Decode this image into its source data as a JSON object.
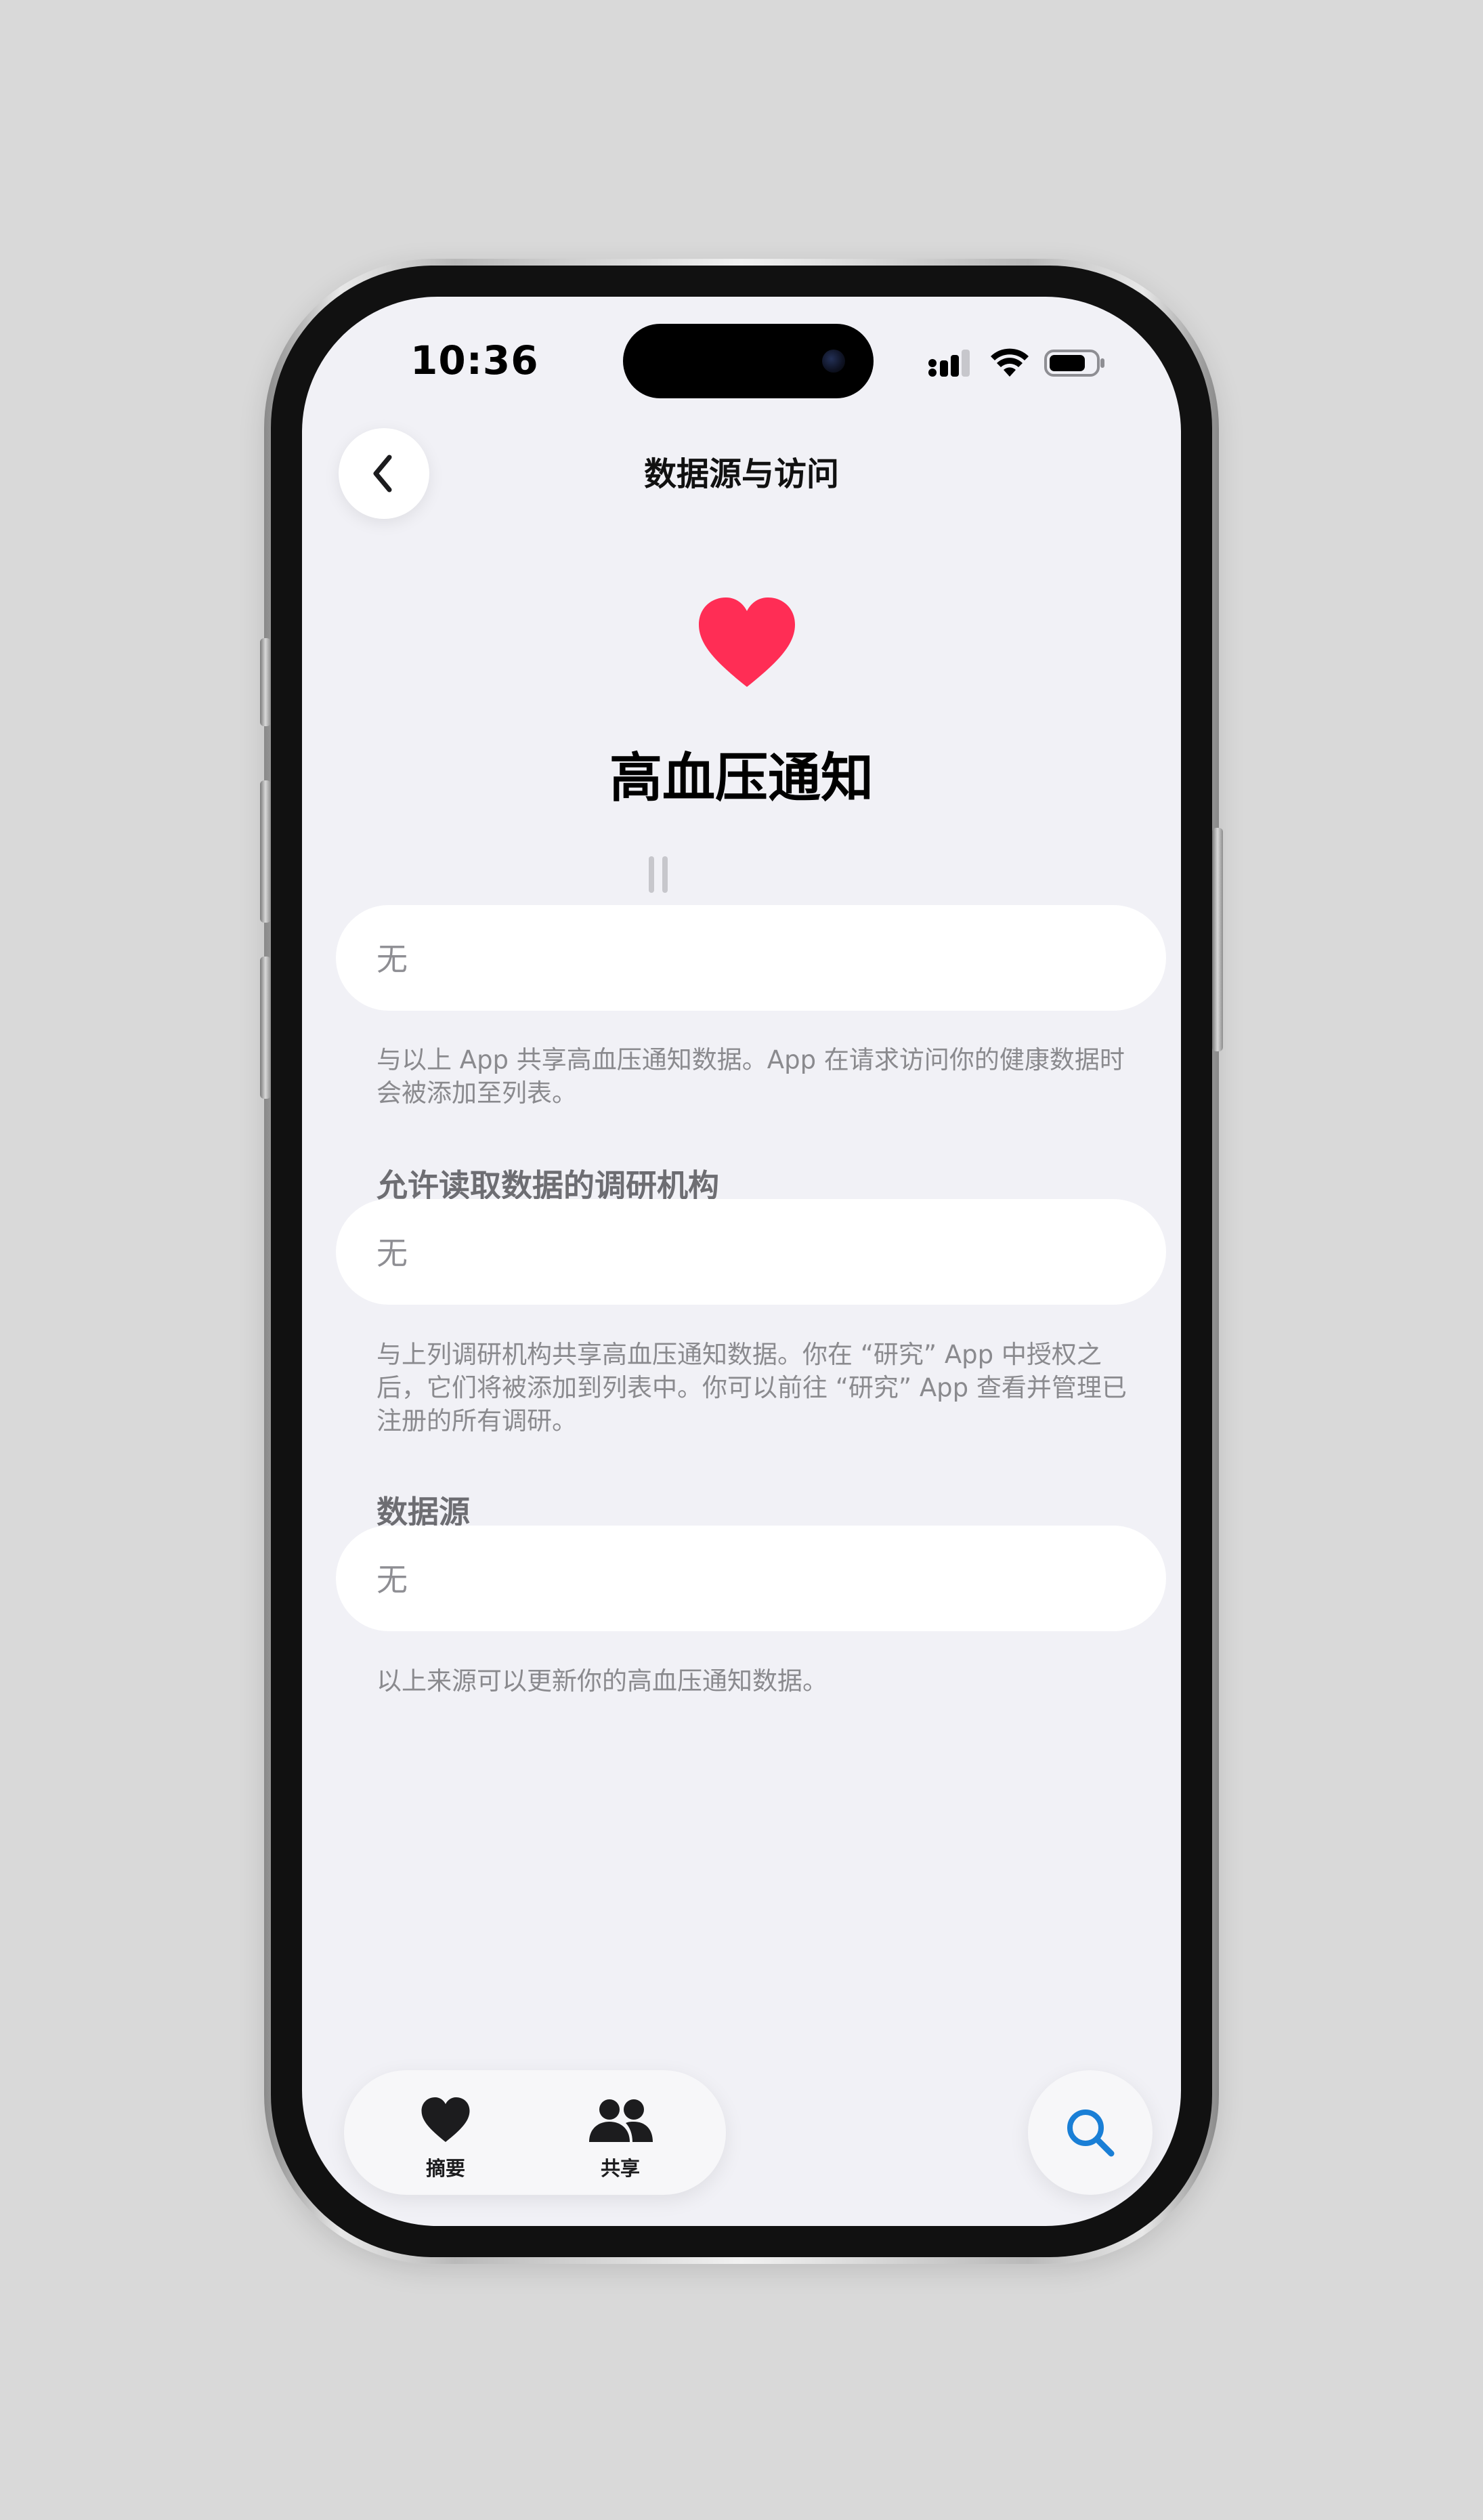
{
  "status_bar": {
    "time": "10:36"
  },
  "nav": {
    "title": "数据源与访问"
  },
  "hero": {
    "title": "高血压通知",
    "icon": "heart-icon",
    "accent_color": "#ff2d55"
  },
  "sections": [
    {
      "header": "",
      "value": "无",
      "footnote": "与以上 App 共享高血压通知数据。App 在请求访问你的健康数据时会被添加至列表。"
    },
    {
      "header": "允许读取数据的调研机构",
      "value": "无",
      "footnote": "与上列调研机构共享高血压通知数据。你在 “研究” App 中授权之后，它们将被添加到列表中。你可以前往 “研究” App 查看并管理已注册的所有调研。"
    },
    {
      "header": "数据源",
      "value": "无",
      "footnote": "以上来源可以更新你的高血压通知数据。"
    }
  ],
  "tabbar": {
    "items": [
      {
        "label": "摘要",
        "icon": "heart-fill-icon"
      },
      {
        "label": "共享",
        "icon": "people-icon"
      }
    ],
    "search_icon": "search-icon",
    "search_color": "#1a7fd6"
  }
}
